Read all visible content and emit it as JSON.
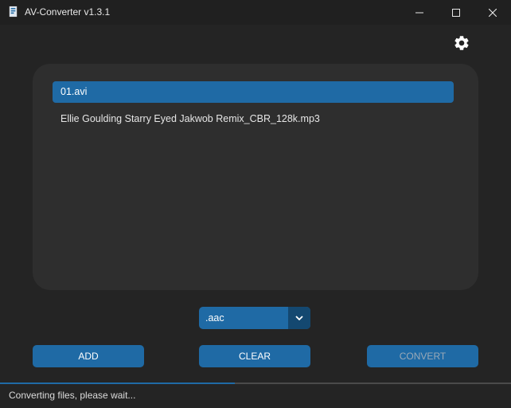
{
  "window": {
    "title": "AV-Converter v1.3.1",
    "icons": {
      "app": "app-logo-icon",
      "minimize": "minimize-icon",
      "maximize": "maximize-icon",
      "close": "close-icon"
    }
  },
  "settings": {
    "icon": "gear-icon"
  },
  "files": {
    "items": [
      {
        "name": "01.avi",
        "selected": true
      },
      {
        "name": "Ellie Goulding Starry Eyed Jakwob Remix_CBR_128k.mp3",
        "selected": false
      }
    ]
  },
  "format_select": {
    "value": ".aac",
    "icon": "chevron-down-icon"
  },
  "buttons": {
    "add": "ADD",
    "clear": "CLEAR",
    "convert": "CONVERT"
  },
  "status": {
    "text": "Converting files, please wait...",
    "progress": 0.46
  },
  "colors": {
    "background": "#242424",
    "panel": "#2e2e2e",
    "accent": "#1f6aa5",
    "accent_dark": "#144870",
    "titlebar": "#202020"
  }
}
